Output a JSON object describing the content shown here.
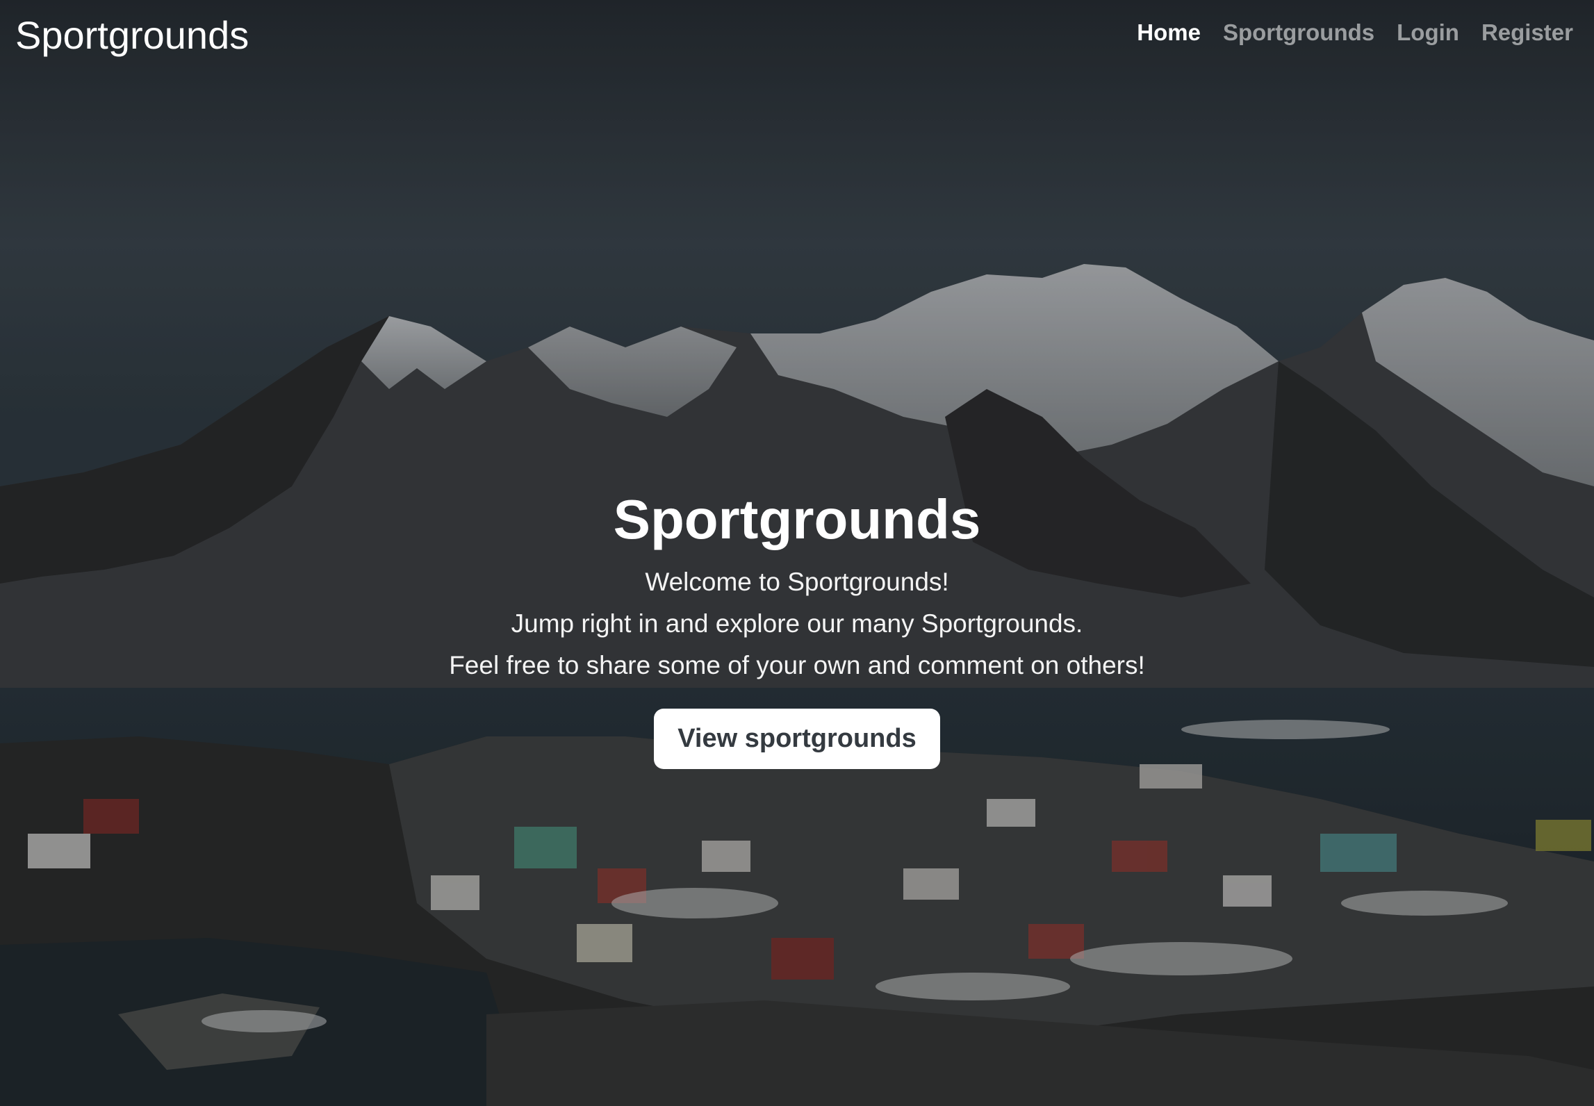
{
  "navbar": {
    "brand": "Sportgrounds",
    "links": [
      {
        "label": "Home",
        "active": true
      },
      {
        "label": "Sportgrounds",
        "active": false
      },
      {
        "label": "Login",
        "active": false
      },
      {
        "label": "Register",
        "active": false
      }
    ]
  },
  "hero": {
    "title": "Sportgrounds",
    "lines": [
      "Welcome to Sportgrounds!",
      "Jump right in and explore our many Sportgrounds.",
      "Feel free to share some of your own and comment on others!"
    ],
    "cta_label": "View sportgrounds"
  },
  "colors": {
    "nav_active": "#ffffff",
    "nav_inactive": "#8c8f92",
    "button_bg": "#ffffff",
    "button_text": "#343a40"
  }
}
